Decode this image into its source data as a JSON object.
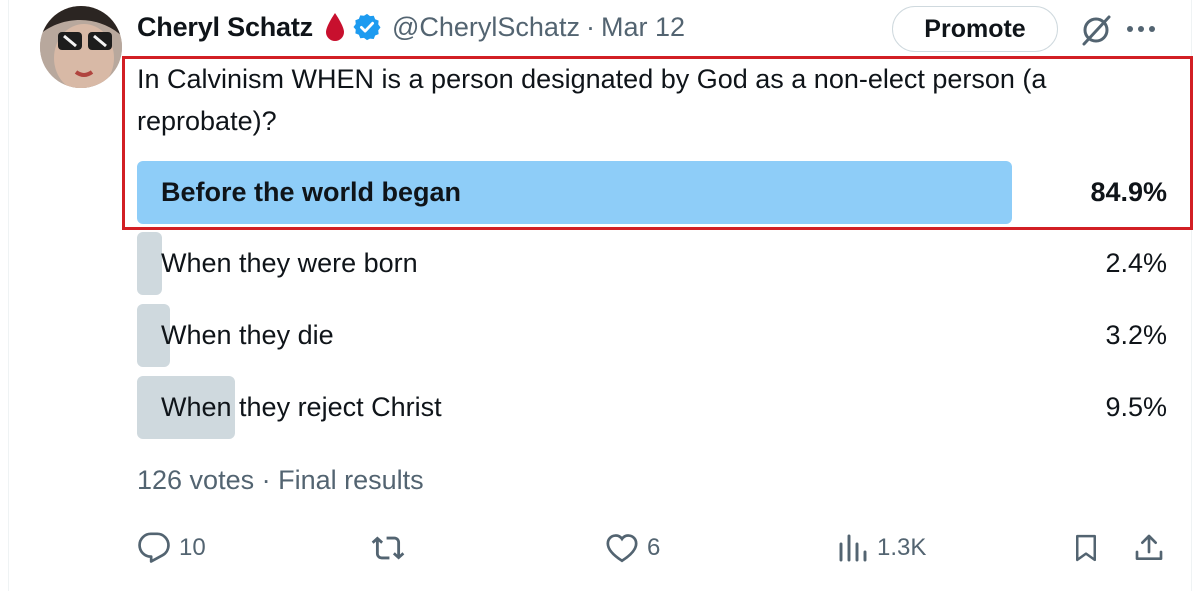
{
  "tweet": {
    "author_name": "Cheryl Schatz",
    "handle": "@CherylSchatz",
    "separator": "·",
    "date": "Mar 12",
    "promote_label": "Promote",
    "question": "In Calvinism WHEN is a person designated by God as a non-elect person (a reprobate)?"
  },
  "poll": {
    "options": [
      {
        "label": "Before the world began",
        "percent": "84.9%",
        "value": 84.9,
        "winner": true
      },
      {
        "label": "When they were born",
        "percent": "2.4%",
        "value": 2.4,
        "winner": false
      },
      {
        "label": "When they die",
        "percent": "3.2%",
        "value": 3.2,
        "winner": false
      },
      {
        "label": "When they reject Christ",
        "percent": "9.5%",
        "value": 9.5,
        "winner": false
      }
    ],
    "summary": "126 votes · Final results"
  },
  "actions": {
    "replies": "10",
    "likes": "6",
    "views": "1.3K"
  },
  "colors": {
    "winner_bar": "#8ecdf8",
    "other_bar": "#cfd9de",
    "verified": "#1d9bf0",
    "drop": "#c8102e",
    "highlight_box": "#d21f24"
  },
  "icons": [
    "blood-drop-icon",
    "verified-badge-icon",
    "grok-icon",
    "more-icon",
    "reply-icon",
    "retweet-icon",
    "like-icon",
    "views-icon",
    "bookmark-icon",
    "share-icon"
  ]
}
